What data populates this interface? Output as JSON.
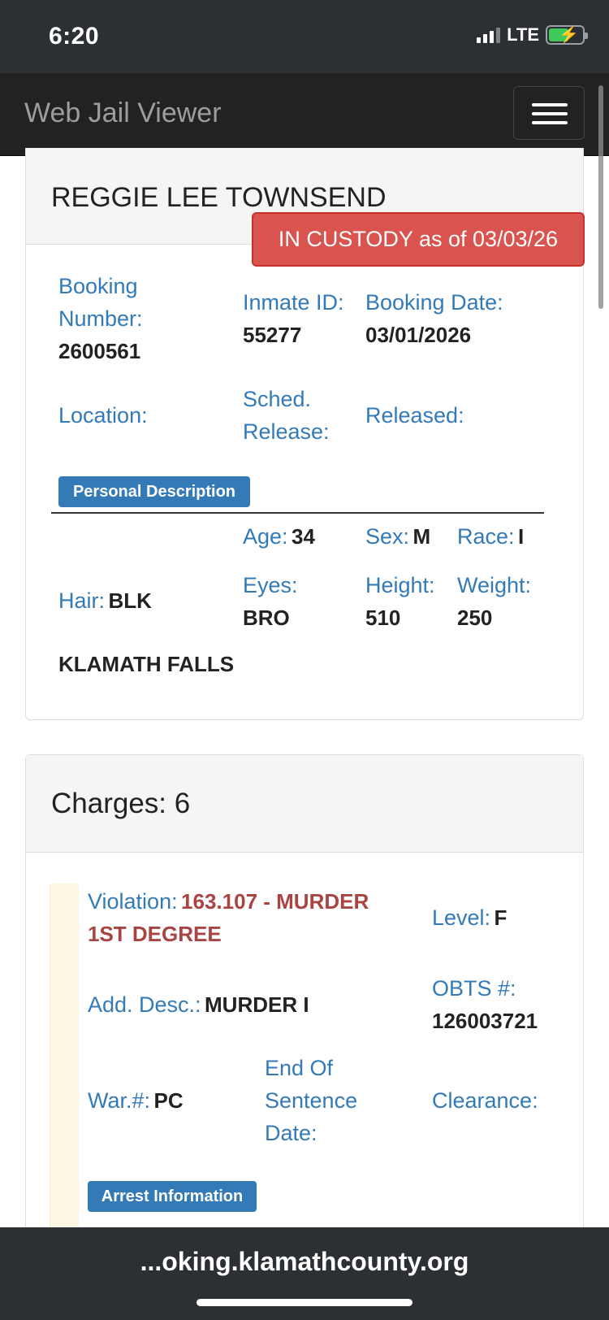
{
  "status_bar": {
    "time": "6:20",
    "network": "LTE"
  },
  "navbar": {
    "brand": "Web Jail Viewer"
  },
  "inmate": {
    "name": "REGGIE LEE TOWNSEND",
    "custody_status": "IN CUSTODY as of 03/03/26",
    "booking_number_label_1": "Booking",
    "booking_number_label_2": "Number:",
    "booking_number": "2600561",
    "inmate_id_label": "Inmate ID:",
    "inmate_id": "55277",
    "booking_date_label": "Booking Date:",
    "booking_date": "03/01/2026",
    "location_label": "Location:",
    "sched_release_label_1": "Sched.",
    "sched_release_label_2": "Release:",
    "released_label": "Released:",
    "personal_description_label": "Personal Description",
    "age_label": "Age:",
    "age": "34",
    "sex_label": "Sex:",
    "sex": "M",
    "race_label": "Race:",
    "race": "I",
    "hair_label": "Hair:",
    "hair": "BLK",
    "eyes_label": "Eyes:",
    "eyes": "BRO",
    "height_label": "Height:",
    "height": "510",
    "weight_label": "Weight:",
    "weight": "250",
    "city": "KLAMATH FALLS"
  },
  "charges": {
    "title": "Charges: 6",
    "items": [
      {
        "violation_label": "Violation:",
        "violation_line_1": "163.107 - MURDER",
        "violation_line_2": "1ST DEGREE",
        "level_label": "Level:",
        "level": "F",
        "add_desc_label": "Add. Desc.:",
        "add_desc": "MURDER I",
        "obts_label": "OBTS #:",
        "obts": "126003721",
        "warrant_label": "War.#:",
        "warrant": "PC",
        "end_of_sentence_label_1": "End Of",
        "end_of_sentence_label_2": "Sentence",
        "end_of_sentence_label_3": "Date:",
        "clearance_label": "Clearance:",
        "arrest_info_label": "Arrest Information"
      }
    ]
  },
  "browser": {
    "url": "...oking.klamathcounty.org"
  },
  "colors": {
    "label_blue": "#337ab7",
    "custody_red": "#d9534f",
    "danger_text": "#a94442",
    "navbar": "#222222"
  }
}
